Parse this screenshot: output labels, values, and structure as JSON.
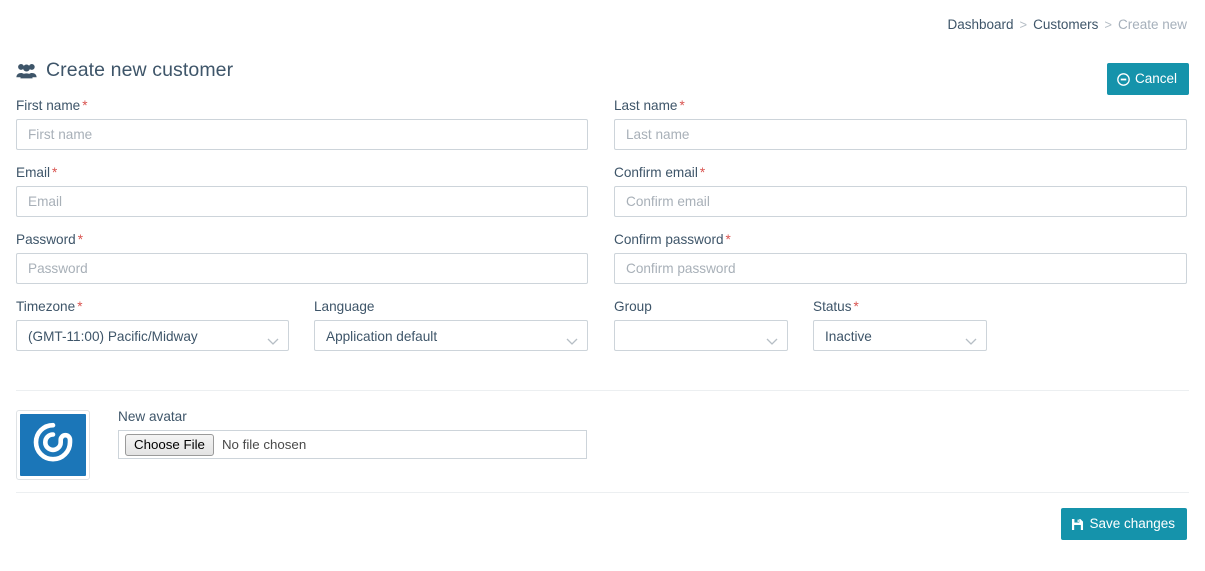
{
  "breadcrumb": {
    "items": [
      {
        "label": "Dashboard",
        "current": false
      },
      {
        "label": "Customers",
        "current": false
      },
      {
        "label": "Create new",
        "current": true
      }
    ],
    "separator": ">"
  },
  "header": {
    "title": "Create new customer",
    "icon": "users-icon",
    "cancel_button": {
      "label": "Cancel",
      "icon": "ban-circle-icon"
    }
  },
  "footer": {
    "save_button": {
      "label": "Save changes",
      "icon": "floppy-save-icon"
    }
  },
  "colors": {
    "accent": "#1593ab",
    "required_asterisk": "#d9534f",
    "label_text": "#3e5569",
    "placeholder": "#a8b0b8",
    "input_border": "#cdd4da",
    "divider": "#eceff1",
    "avatar_background": "#1b76b8"
  },
  "form": {
    "first_name": {
      "label": "First name",
      "required": true,
      "placeholder": "First name",
      "value": ""
    },
    "last_name": {
      "label": "Last name",
      "required": true,
      "placeholder": "Last name",
      "value": ""
    },
    "email": {
      "label": "Email",
      "required": true,
      "placeholder": "Email",
      "value": ""
    },
    "confirm_email": {
      "label": "Confirm email",
      "required": true,
      "placeholder": "Confirm email",
      "value": ""
    },
    "password": {
      "label": "Password",
      "required": true,
      "placeholder": "Password",
      "value": ""
    },
    "confirm_password": {
      "label": "Confirm password",
      "required": true,
      "placeholder": "Confirm password",
      "value": ""
    },
    "timezone": {
      "label": "Timezone",
      "required": true,
      "value": "(GMT-11:00) Pacific/Midway"
    },
    "language": {
      "label": "Language",
      "required": false,
      "value": "Application default"
    },
    "group": {
      "label": "Group",
      "required": false,
      "value": ""
    },
    "status": {
      "label": "Status",
      "required": true,
      "value": "Inactive"
    }
  },
  "avatar": {
    "label": "New avatar",
    "image_alt": "gravatar-logo",
    "choose_button": "Choose File",
    "file_status": "No file chosen"
  },
  "required_marker": "*"
}
